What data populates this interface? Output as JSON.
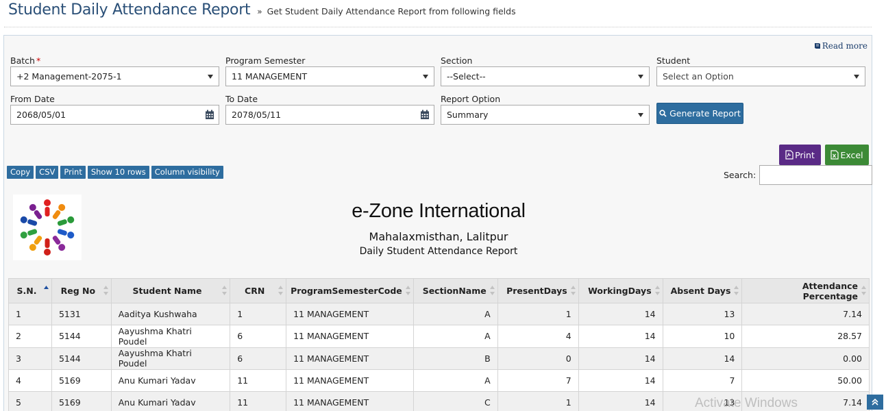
{
  "header": {
    "title": "Student Daily Attendance Report",
    "subtitle_prefix": "»",
    "subtitle": "Get Student Daily Attendance Report from following fields"
  },
  "read_more": "Read more",
  "filters": {
    "batch": {
      "label": "Batch",
      "required_mark": "*",
      "value": "+2 Management-2075-1"
    },
    "program_semester": {
      "label": "Program Semester",
      "value": "11 MANAGEMENT"
    },
    "section": {
      "label": "Section",
      "value": "--Select--"
    },
    "student": {
      "label": "Student",
      "value": "Select an Option"
    },
    "from_date": {
      "label": "From Date",
      "value": "2068/05/01"
    },
    "to_date": {
      "label": "To Date",
      "value": "2078/05/11"
    },
    "report_option": {
      "label": "Report Option",
      "value": "Summary"
    }
  },
  "generate_button": "Generate Report",
  "export": {
    "print": "Print",
    "excel": "Excel"
  },
  "dt_buttons": [
    "Copy",
    "CSV",
    "Print",
    "Show 10 rows",
    "Column visibility"
  ],
  "search": {
    "label": "Search:",
    "value": ""
  },
  "report_header": {
    "org_name": "e-Zone International",
    "address": "Mahalaxmisthan, Lalitpur",
    "report_title": "Daily Student Attendance Report"
  },
  "table": {
    "columns": [
      "S.N.",
      "Reg No",
      "Student Name",
      "CRN",
      "ProgramSemesterCode",
      "SectionName",
      "PresentDays",
      "WorkingDays",
      "Absent Days",
      "Attendance Percentage"
    ],
    "rows": [
      [
        "1",
        "5131",
        "Aaditya Kushwaha",
        "1",
        "11 MANAGEMENT",
        "A",
        "1",
        "14",
        "13",
        "7.14"
      ],
      [
        "2",
        "5144",
        "Aayushma Khatri Poudel",
        "6",
        "11 MANAGEMENT",
        "A",
        "4",
        "14",
        "10",
        "28.57"
      ],
      [
        "3",
        "5144",
        "Aayushma Khatri Poudel",
        "6",
        "11 MANAGEMENT",
        "B",
        "0",
        "14",
        "14",
        "0.00"
      ],
      [
        "4",
        "5169",
        "Anu Kumari Yadav",
        "11",
        "11 MANAGEMENT",
        "A",
        "7",
        "14",
        "7",
        "50.00"
      ],
      [
        "5",
        "5169",
        "Anu Kumari Yadav",
        "11",
        "11 MANAGEMENT",
        "C",
        "1",
        "14",
        "13",
        "7.14"
      ]
    ]
  },
  "watermark": "Activate Windows",
  "colors": {
    "primary": "#2e6d9f",
    "print": "#5a2a86",
    "excel": "#3c8a36",
    "title": "#2a4f77"
  }
}
